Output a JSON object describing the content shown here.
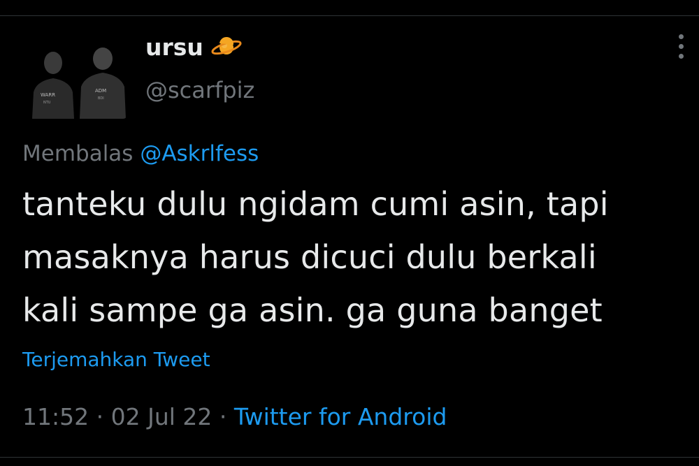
{
  "author": {
    "display_name": "ursu",
    "handle": "@scarfpiz",
    "badge_icon": "ringed-planet-icon"
  },
  "reply": {
    "prefix": "Membalas",
    "mention": "@Askrlfess"
  },
  "tweet": {
    "lines": [
      "tanteku dulu ngidam cumi asin, tapi",
      "masaknya harus dicuci dulu berkali",
      "kali sampe ga asin. ga guna banget"
    ]
  },
  "translate_label": "Terjemahkan Tweet",
  "meta": {
    "time": "11:52",
    "separator": "·",
    "date": "02 Jul 22",
    "source": "Twitter for Android"
  },
  "colors": {
    "background": "#000000",
    "text_primary": "#e7e9ea",
    "text_secondary": "#71767b",
    "accent_blue": "#1d9bf0",
    "divider": "#2f3336"
  }
}
